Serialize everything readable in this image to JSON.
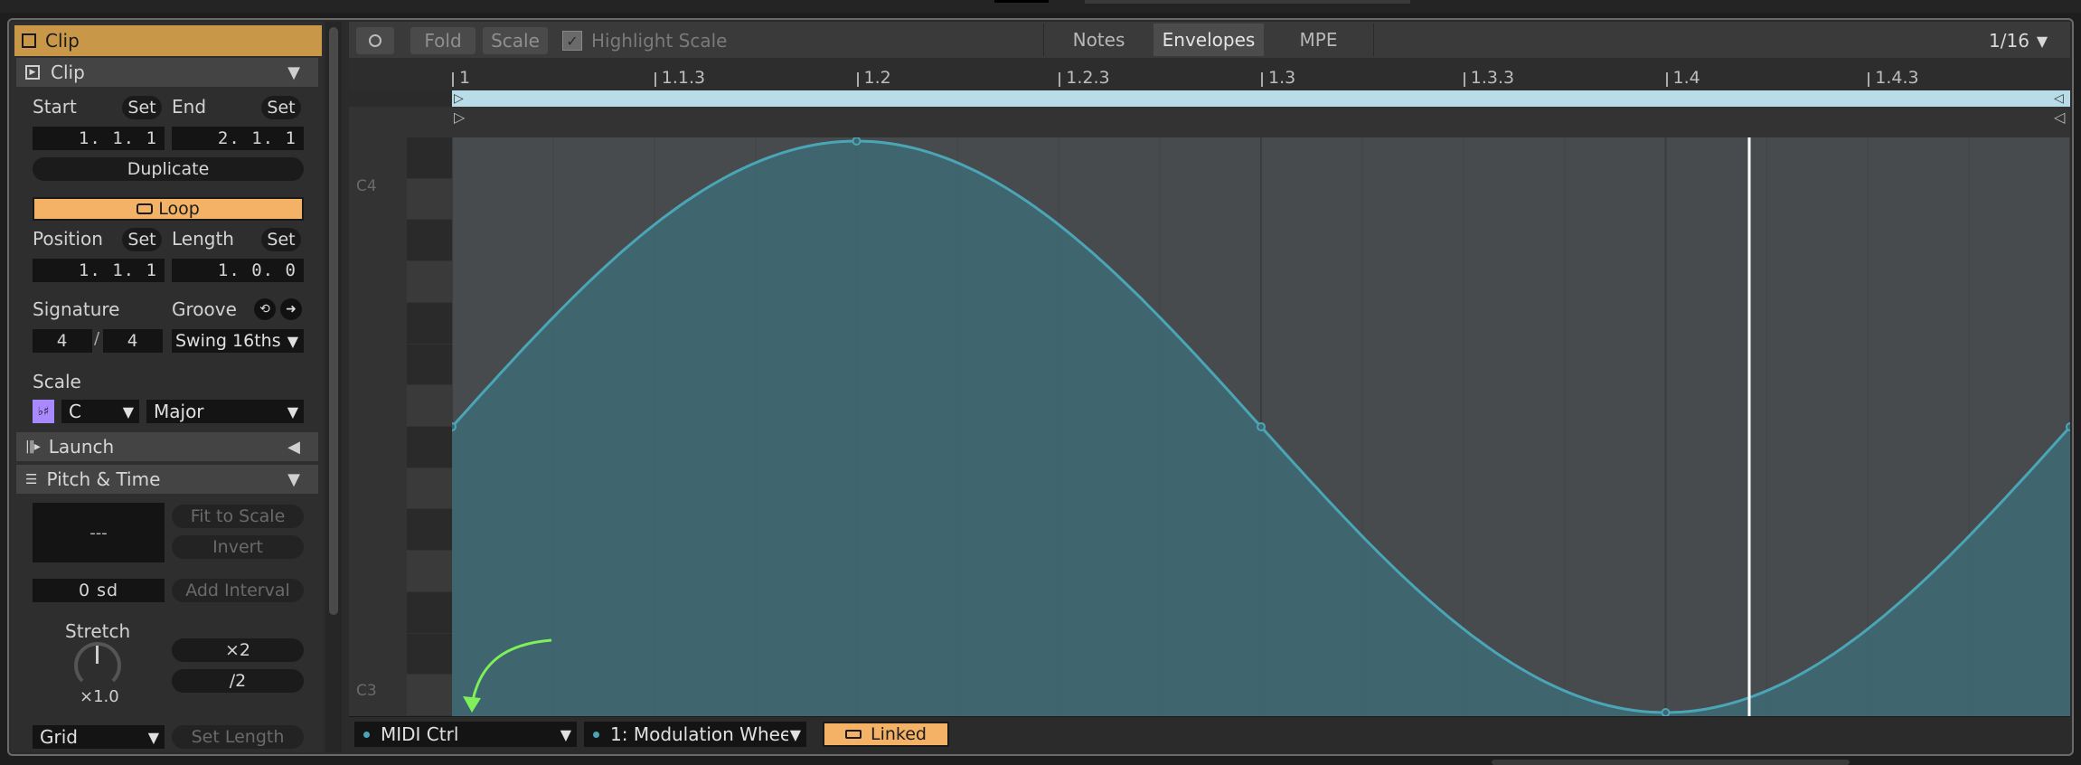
{
  "left_panel": {
    "header_title": "Clip",
    "clip_section_title": "Clip",
    "start_label": "Start",
    "end_label": "End",
    "set_label": "Set",
    "start_value": "1.  1.  1",
    "end_value": "2.  1.  1",
    "duplicate_label": "Duplicate",
    "loop_label": "Loop",
    "position_label": "Position",
    "length_label": "Length",
    "position_value": "1.  1.  1",
    "length_value": "1.  0.  0",
    "signature_label": "Signature",
    "groove_label": "Groove",
    "sig_numerator": "4",
    "sig_denominator": "4",
    "sig_slash": "/",
    "groove_value": "Swing 16ths",
    "scale_label": "Scale",
    "scale_icon_text": "♭♯",
    "scale_root": "C",
    "scale_mode": "Major",
    "launch_title": "Launch",
    "pitch_time_title": "Pitch & Time",
    "pitch_display": "---",
    "fit_to_scale_label": "Fit to Scale",
    "invert_label": "Invert",
    "sd_value": "0 sd",
    "add_interval_label": "Add Interval",
    "stretch_label": "Stretch",
    "stretch_value": "×1.0",
    "double_label": "×2",
    "half_label": "/2",
    "grid_value": "Grid",
    "set_length_label": "Set Length"
  },
  "toolbar": {
    "fold_label": "Fold",
    "scale_label": "Scale",
    "highlight_scale_label": "Highlight Scale",
    "tab_notes": "Notes",
    "tab_envelopes": "Envelopes",
    "tab_mpe": "MPE",
    "grid_value": "1/16"
  },
  "ruler": {
    "labels": [
      "1",
      "1.1.3",
      "1.2",
      "1.2.3",
      "1.3",
      "1.3.3",
      "1.4",
      "1.4.3"
    ]
  },
  "piano": {
    "c4_label": "C4",
    "c3_label": "C3"
  },
  "bottom_bar": {
    "device_value": "MIDI Ctrl",
    "control_value": "1: Modulation Whee",
    "linked_label": "Linked"
  },
  "colors": {
    "accent_orange": "#f4b266",
    "envelope_line": "#4aa6b7",
    "envelope_fill": "#3f6670",
    "loop_bar": "#b9dce9",
    "arrow_green": "#7ef05a"
  }
}
